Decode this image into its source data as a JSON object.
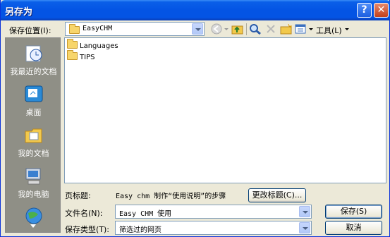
{
  "window": {
    "title": "另存为"
  },
  "toolbar": {
    "location_label": "保存位置(I):",
    "location_value": "EasyCHM",
    "tools_label": "工具(L)"
  },
  "places": [
    {
      "label": "我最近的文档",
      "icon": "recent-documents-icon"
    },
    {
      "label": "桌面",
      "icon": "desktop-icon"
    },
    {
      "label": "我的文档",
      "icon": "my-documents-icon"
    },
    {
      "label": "我的电脑",
      "icon": "my-computer-icon"
    },
    {
      "label": "",
      "icon": "network-places-icon"
    }
  ],
  "files": [
    {
      "name": "Languages"
    },
    {
      "name": "TIPS"
    }
  ],
  "page_title": {
    "label": "页标题:",
    "value": "Easy chm 制作“使用说明”的步骤",
    "change_button": "更改标题(C)..."
  },
  "filename": {
    "label": "文件名(N):",
    "value": "Easy CHM 使用"
  },
  "filetype": {
    "label": "保存类型(T):",
    "value": "筛选过的网页"
  },
  "buttons": {
    "save": "保存(S)",
    "cancel": "取消"
  },
  "colors": {
    "titlebar": "#0454e4",
    "places_bg": "#8f8f86",
    "dialog_bg": "#ece9d8"
  }
}
